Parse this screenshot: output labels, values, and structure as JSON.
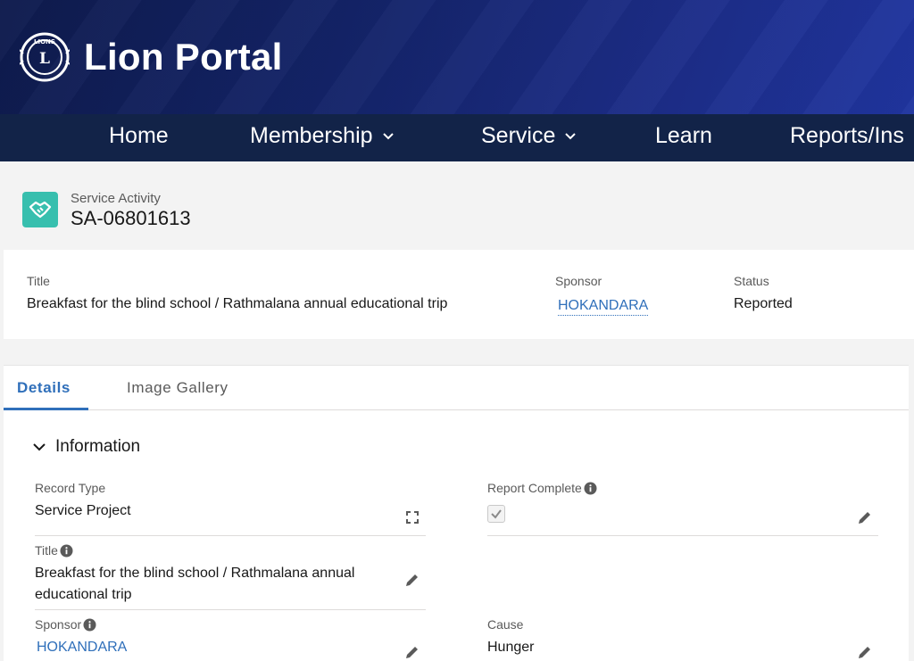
{
  "brand": {
    "title": "Lion Portal",
    "logo_text": "LIONS"
  },
  "nav": {
    "items": [
      {
        "label": "Home"
      },
      {
        "label": "Membership"
      },
      {
        "label": "Service"
      },
      {
        "label": "Learn"
      },
      {
        "label": "Reports/Ins"
      }
    ]
  },
  "record": {
    "object_type": "Service Activity",
    "name": "SA-06801613"
  },
  "highlights": {
    "title_label": "Title",
    "title_value": "Breakfast for the blind school / Rathmalana annual educational trip",
    "sponsor_label": "Sponsor",
    "sponsor_value": "HOKANDARA",
    "status_label": "Status",
    "status_value": "Reported"
  },
  "tabs": [
    {
      "label": "Details",
      "active": true
    },
    {
      "label": "Image Gallery",
      "active": false
    }
  ],
  "section": {
    "title": "Information"
  },
  "fields": {
    "record_type_label": "Record Type",
    "record_type_value": "Service Project",
    "report_complete_label": "Report Complete",
    "report_complete_value": true,
    "title_label": "Title",
    "title_value_line1": "Breakfast for the blind school / Rathmalana annual",
    "title_value_line2": "educational trip",
    "sponsor_label": "Sponsor",
    "sponsor_value": "HOKANDARA",
    "cause_label": "Cause",
    "cause_value": "Hunger"
  },
  "colors": {
    "nav_bg": "#122348",
    "brand_gradient_start": "#0e1b4d",
    "brand_gradient_end": "#2035a0",
    "accent": "#2f6fba",
    "object_icon": "#37bfae"
  },
  "icons": [
    "lions-logo",
    "chevron-down-icon",
    "handshake-icon",
    "info-icon",
    "pencil-icon",
    "change-record-type-icon",
    "checkbox"
  ]
}
